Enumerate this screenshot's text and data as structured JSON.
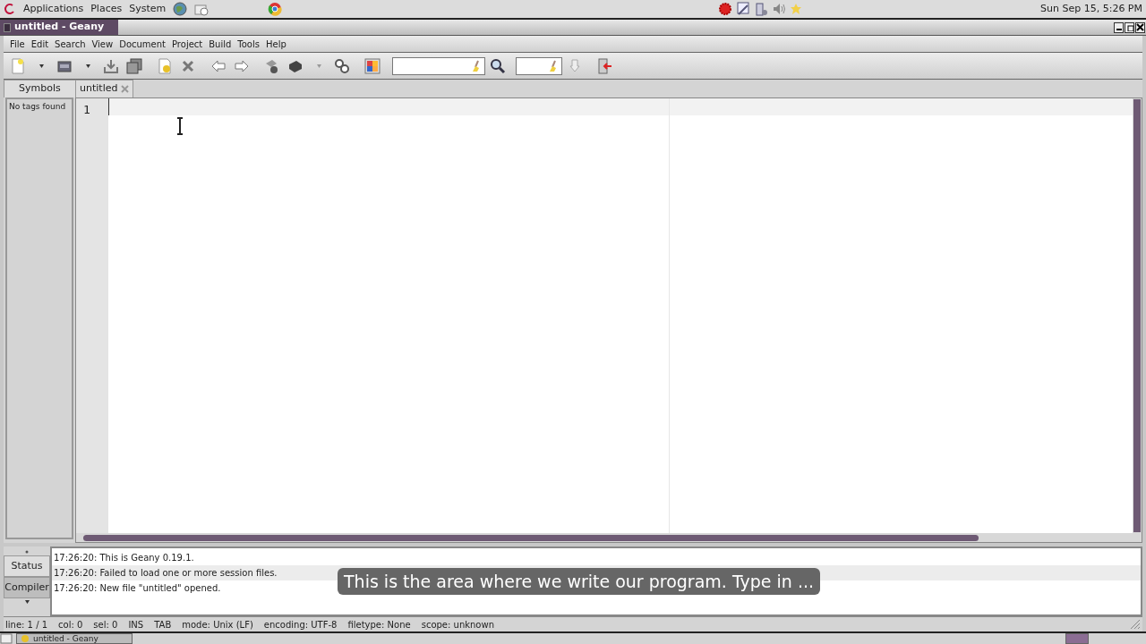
{
  "top_panel": {
    "menus": [
      "Applications",
      "Places",
      "System"
    ],
    "clock": "Sun Sep 15,  5:26 PM"
  },
  "window": {
    "title": "untitled - Geany"
  },
  "menu_bar": [
    "File",
    "Edit",
    "Search",
    "View",
    "Document",
    "Project",
    "Build",
    "Tools",
    "Help"
  ],
  "sidebar": {
    "tabs": [
      {
        "label": "Symbols",
        "selected": true
      }
    ],
    "message": "No tags found"
  },
  "editor": {
    "tabs": [
      {
        "label": "untitled",
        "selected": true
      }
    ],
    "line_numbers": [
      "1"
    ]
  },
  "messages": {
    "tabs": [
      {
        "label": "Status",
        "selected": true
      },
      {
        "label": "Compiler",
        "selected": false
      }
    ],
    "lines": [
      {
        "text": "17:26:20: This is Geany 0.19.1.",
        "selected": false
      },
      {
        "text": "17:26:20: Failed to load one or more session files.",
        "selected": true
      },
      {
        "text": "17:26:20: New file \"untitled\" opened.",
        "selected": false
      }
    ]
  },
  "status_bar": [
    "line: 1 / 1",
    "col: 0",
    "sel: 0",
    "INS",
    "TAB",
    "mode: Unix (LF)",
    "encoding: UTF-8",
    "filetype: None",
    "scope: unknown"
  ],
  "taskbar": {
    "window_button": "untitled - Geany"
  },
  "caption": "This is the area where we write our program. Type in ..."
}
